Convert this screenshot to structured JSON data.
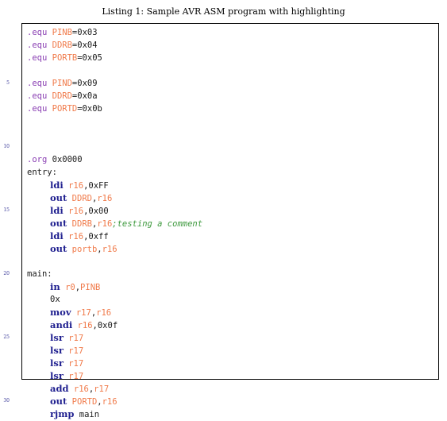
{
  "caption": "Listing 1: Sample AVR ASM program with highlighting",
  "line_numbers": [
    "5",
    "10",
    "15",
    "20",
    "25",
    "30"
  ],
  "lines": [
    {
      "indent": false,
      "tokens": [
        {
          "t": ".equ",
          "k": "dir"
        },
        {
          "t": " ",
          "k": "plain"
        },
        {
          "t": "PINB",
          "k": "sym"
        },
        {
          "t": "=0x03",
          "k": "plain"
        }
      ]
    },
    {
      "indent": false,
      "tokens": [
        {
          "t": ".equ",
          "k": "dir"
        },
        {
          "t": " ",
          "k": "plain"
        },
        {
          "t": "DDRB",
          "k": "sym"
        },
        {
          "t": "=0x04",
          "k": "plain"
        }
      ]
    },
    {
      "indent": false,
      "tokens": [
        {
          "t": ".equ",
          "k": "dir"
        },
        {
          "t": " ",
          "k": "plain"
        },
        {
          "t": "PORTB",
          "k": "sym"
        },
        {
          "t": "=0x05",
          "k": "plain"
        }
      ]
    },
    {
      "indent": false,
      "tokens": []
    },
    {
      "indent": false,
      "tokens": [
        {
          "t": ".equ",
          "k": "dir"
        },
        {
          "t": " ",
          "k": "plain"
        },
        {
          "t": "PIND",
          "k": "sym"
        },
        {
          "t": "=0x09",
          "k": "plain"
        }
      ]
    },
    {
      "indent": false,
      "tokens": [
        {
          "t": ".equ",
          "k": "dir"
        },
        {
          "t": " ",
          "k": "plain"
        },
        {
          "t": "DDRD",
          "k": "sym"
        },
        {
          "t": "=0x0a",
          "k": "plain"
        }
      ]
    },
    {
      "indent": false,
      "tokens": [
        {
          "t": ".equ",
          "k": "dir"
        },
        {
          "t": " ",
          "k": "plain"
        },
        {
          "t": "PORTD",
          "k": "sym"
        },
        {
          "t": "=0x0b",
          "k": "plain"
        }
      ]
    },
    {
      "indent": false,
      "tokens": []
    },
    {
      "indent": false,
      "tokens": []
    },
    {
      "indent": false,
      "tokens": []
    },
    {
      "indent": false,
      "tokens": [
        {
          "t": ".org",
          "k": "dir"
        },
        {
          "t": " 0x0000",
          "k": "plain"
        }
      ]
    },
    {
      "indent": false,
      "tokens": [
        {
          "t": "entry:",
          "k": "plain"
        }
      ]
    },
    {
      "indent": true,
      "tokens": [
        {
          "t": "ldi",
          "k": "mn"
        },
        {
          "t": " ",
          "k": "plain"
        },
        {
          "t": "r16",
          "k": "sym"
        },
        {
          "t": ",0xFF",
          "k": "plain"
        }
      ]
    },
    {
      "indent": true,
      "tokens": [
        {
          "t": "out",
          "k": "mn"
        },
        {
          "t": " ",
          "k": "plain"
        },
        {
          "t": "DDRD",
          "k": "sym"
        },
        {
          "t": ",",
          "k": "plain"
        },
        {
          "t": "r16",
          "k": "sym"
        }
      ]
    },
    {
      "indent": true,
      "tokens": [
        {
          "t": "ldi",
          "k": "mn"
        },
        {
          "t": " ",
          "k": "plain"
        },
        {
          "t": "r16",
          "k": "sym"
        },
        {
          "t": ",0x00",
          "k": "plain"
        }
      ]
    },
    {
      "indent": true,
      "tokens": [
        {
          "t": "out",
          "k": "mn"
        },
        {
          "t": " ",
          "k": "plain"
        },
        {
          "t": "DDRB",
          "k": "sym"
        },
        {
          "t": ",",
          "k": "plain"
        },
        {
          "t": "r16",
          "k": "sym"
        },
        {
          "t": ";testing a comment",
          "k": "cmt"
        }
      ]
    },
    {
      "indent": true,
      "tokens": [
        {
          "t": "ldi",
          "k": "mn"
        },
        {
          "t": " ",
          "k": "plain"
        },
        {
          "t": "r16",
          "k": "sym"
        },
        {
          "t": ",0xff",
          "k": "plain"
        }
      ]
    },
    {
      "indent": true,
      "tokens": [
        {
          "t": "out",
          "k": "mn"
        },
        {
          "t": " ",
          "k": "plain"
        },
        {
          "t": "portb",
          "k": "sym"
        },
        {
          "t": ",",
          "k": "plain"
        },
        {
          "t": "r16",
          "k": "sym"
        }
      ]
    },
    {
      "indent": false,
      "tokens": []
    },
    {
      "indent": false,
      "tokens": [
        {
          "t": "main:",
          "k": "plain"
        }
      ]
    },
    {
      "indent": true,
      "tokens": [
        {
          "t": "in",
          "k": "mn"
        },
        {
          "t": " ",
          "k": "plain"
        },
        {
          "t": "r0",
          "k": "sym"
        },
        {
          "t": ",",
          "k": "plain"
        },
        {
          "t": "PINB",
          "k": "sym"
        }
      ]
    },
    {
      "indent": true,
      "tokens": [
        {
          "t": "0x",
          "k": "plain"
        }
      ]
    },
    {
      "indent": true,
      "tokens": [
        {
          "t": "mov",
          "k": "mn"
        },
        {
          "t": " ",
          "k": "plain"
        },
        {
          "t": "r17",
          "k": "sym"
        },
        {
          "t": ",",
          "k": "plain"
        },
        {
          "t": "r16",
          "k": "sym"
        }
      ]
    },
    {
      "indent": true,
      "tokens": [
        {
          "t": "andi",
          "k": "mn"
        },
        {
          "t": " ",
          "k": "plain"
        },
        {
          "t": "r16",
          "k": "sym"
        },
        {
          "t": ",0x0f",
          "k": "plain"
        }
      ]
    },
    {
      "indent": true,
      "tokens": [
        {
          "t": "lsr",
          "k": "mn"
        },
        {
          "t": " ",
          "k": "plain"
        },
        {
          "t": "r17",
          "k": "sym"
        }
      ]
    },
    {
      "indent": true,
      "tokens": [
        {
          "t": "lsr",
          "k": "mn"
        },
        {
          "t": " ",
          "k": "plain"
        },
        {
          "t": "r17",
          "k": "sym"
        }
      ]
    },
    {
      "indent": true,
      "tokens": [
        {
          "t": "lsr",
          "k": "mn"
        },
        {
          "t": " ",
          "k": "plain"
        },
        {
          "t": "r17",
          "k": "sym"
        }
      ]
    },
    {
      "indent": true,
      "tokens": [
        {
          "t": "lsr",
          "k": "mn"
        },
        {
          "t": " ",
          "k": "plain"
        },
        {
          "t": "r17",
          "k": "sym"
        }
      ]
    },
    {
      "indent": true,
      "tokens": [
        {
          "t": "add",
          "k": "mn"
        },
        {
          "t": " ",
          "k": "plain"
        },
        {
          "t": "r16",
          "k": "sym"
        },
        {
          "t": ",",
          "k": "plain"
        },
        {
          "t": "r17",
          "k": "sym"
        }
      ]
    },
    {
      "indent": true,
      "tokens": [
        {
          "t": "out",
          "k": "mn"
        },
        {
          "t": " ",
          "k": "plain"
        },
        {
          "t": "PORTD",
          "k": "sym"
        },
        {
          "t": ",",
          "k": "plain"
        },
        {
          "t": "r16",
          "k": "sym"
        }
      ]
    },
    {
      "indent": true,
      "tokens": [
        {
          "t": "rjmp",
          "k": "mn"
        },
        {
          "t": " main",
          "k": "plain"
        }
      ]
    }
  ]
}
